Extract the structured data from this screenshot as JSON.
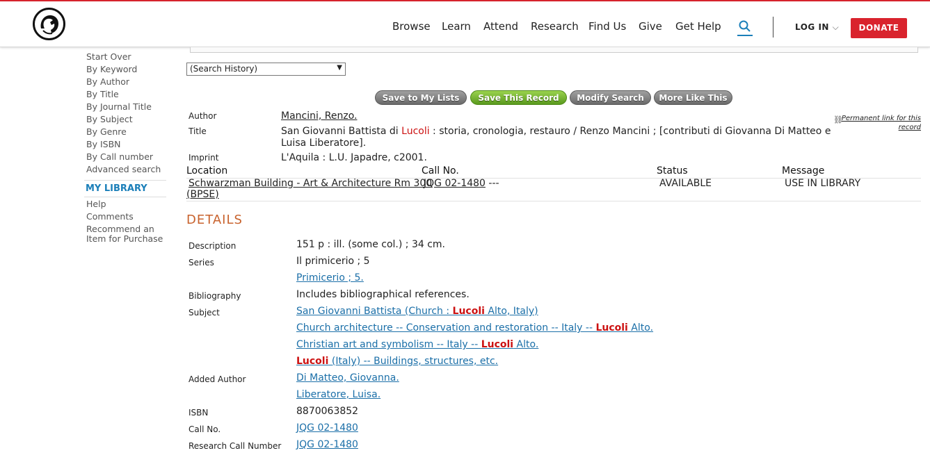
{
  "header": {
    "nav": [
      "Browse",
      "Learn",
      "Attend",
      "Research",
      "Find Us",
      "Give",
      "Get Help"
    ],
    "login": "LOG IN",
    "login_chevron": "⌵",
    "donate": "DONATE",
    "accent_color": "#d9232d",
    "link_color": "#1b7fb9"
  },
  "sidebar": {
    "search_links": [
      "Start Over",
      "By Keyword",
      "By Author",
      "By Title",
      "By Journal Title",
      "By Subject",
      "By Genre",
      "By ISBN",
      "By Call number",
      "Advanced search"
    ],
    "my_library": "MY LIBRARY",
    "help_links": [
      "Help",
      "Comments",
      "Recommend an",
      "Item for Purchase"
    ]
  },
  "search_history": {
    "selected": "(Search History)"
  },
  "buttons": {
    "save_to_my_lists": "Save to My Lists",
    "save_this_record": "Save This Record",
    "modify_search": "Modify Search",
    "more_like_this": "More Like This"
  },
  "record": {
    "author_label": "Author",
    "author": "Mancini, Renzo.",
    "title_label": "Title",
    "title_pre": "San Giovanni Battista di ",
    "title_hl": "Lucoli",
    "title_post": " : storia, cronologia, restauro / Renzo Mancini ; [contributi di Giovanna Di Matteo e",
    "title_line2": "Luisa Liberatore].",
    "imprint_label": "Imprint",
    "imprint": "L'Aquila : L.U. Japadre, c2001.",
    "permalink": "Permanent link for this record"
  },
  "holdings": {
    "headers": [
      "Location",
      "Call No.",
      "Status",
      "Message"
    ],
    "location_line1": "Schwarzman Building - Art & Architecture Rm 300",
    "location_line2": "(BPSE)",
    "call_no": "JQG 02-1480",
    "call_extra": "---",
    "status": "AVAILABLE",
    "message": "USE IN LIBRARY"
  },
  "details": {
    "heading": "DETAILS",
    "description_label": "Description",
    "description": "151 p : ill. (some col.) ; 34 cm.",
    "series_label": "Series",
    "series": "Il primicerio ; 5",
    "series_link": "Primicerio ; 5.",
    "bibliography_label": "Bibliography",
    "bibliography": "Includes bibliographical references.",
    "subject_label": "Subject",
    "subject1_pre": "San Giovanni Battista (Church : ",
    "subject1_hl": "Lucoli",
    "subject1_post": " Alto, Italy)",
    "subject2_pre": "Church architecture -- Conservation and restoration -- Italy -- ",
    "subject2_hl": "Lucoli",
    "subject2_post": " Alto.",
    "subject3_pre": "Christian art and symbolism -- Italy -- ",
    "subject3_hl": "Lucoli",
    "subject3_post": " Alto.",
    "subject4_hl": "Lucoli",
    "subject4_post": " (Italy) -- Buildings, structures, etc.",
    "added_author_label": "Added Author",
    "added_author1": "Di Matteo, Giovanna.",
    "added_author2": "Liberatore, Luisa.",
    "isbn_label": "ISBN",
    "isbn": "8870063852",
    "callno_label": "Call No.",
    "callno": "JQG 02-1480",
    "research_label": "Research Call Number",
    "research_callno": "JQG 02-1480"
  }
}
